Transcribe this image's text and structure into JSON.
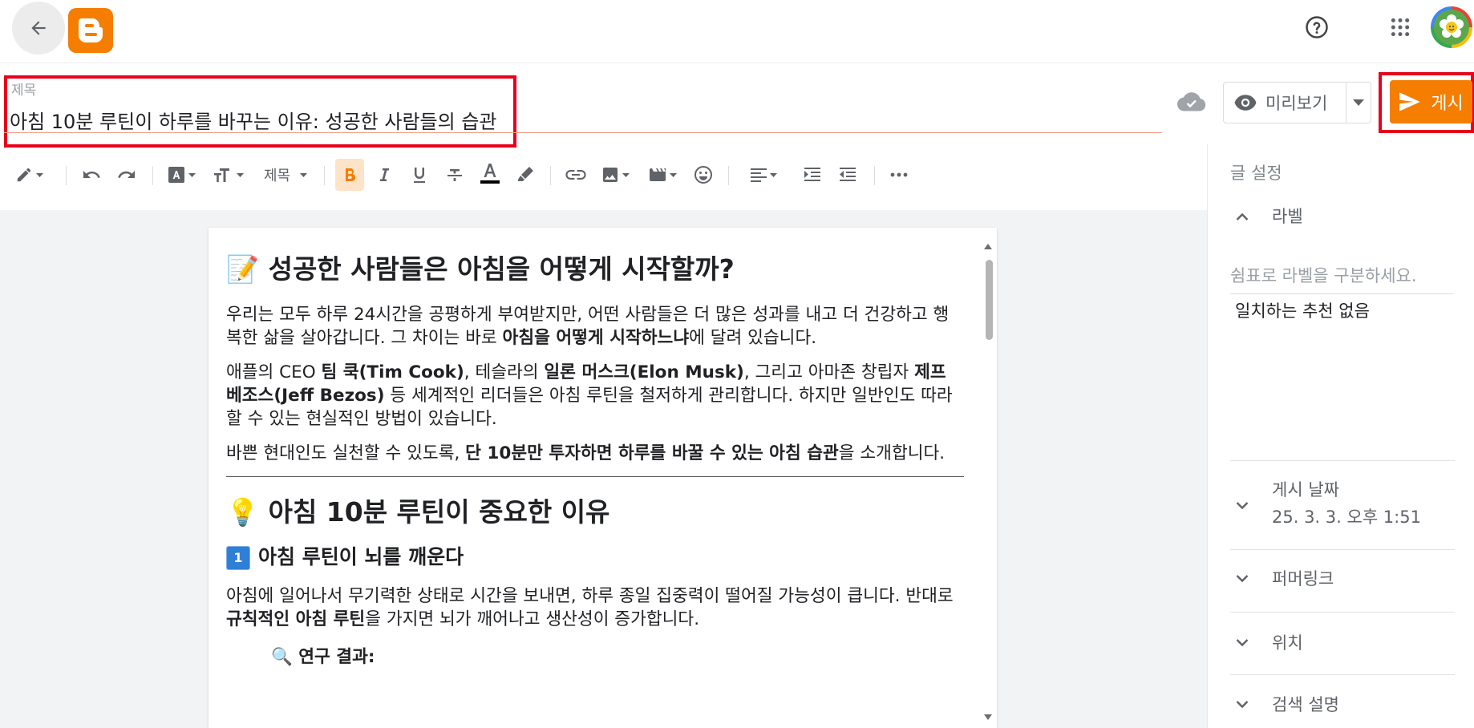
{
  "title": {
    "label": "제목",
    "value": "아침 10분 루틴이 하루를 바꾸는 이유: 성공한 사람들의 습관"
  },
  "header": {
    "preview_label": "미리보기",
    "publish_label": "게시"
  },
  "toolbar": {
    "format_label": "제목"
  },
  "content": {
    "h1": "📝 성공한 사람들은 아침을 어떻게 시작할까?",
    "p1_a": "우리는 모두 하루 24시간을 공평하게 부여받지만, 어떤 사람들은 더 많은 성과를 내고 더 건강하고 행복한 삶을 살아갑니다. 그 차이는 바로 ",
    "p1_b": "아침을 어떻게 시작하느냐",
    "p1_c": "에 달려 있습니다.",
    "p2_a": "애플의 CEO ",
    "p2_b": "팀 쿡(Tim Cook)",
    "p2_c": ", 테슬라의 ",
    "p2_d": "일론 머스크(Elon Musk)",
    "p2_e": ", 그리고 아마존 창립자 ",
    "p2_f": "제프 베조스(Jeff Bezos)",
    "p2_g": " 등 세계적인 리더들은 아침 루틴을 철저하게 관리합니다. 하지만 일반인도 따라 할 수 있는 현실적인 방법이 있습니다.",
    "p3_a": "바쁜 현대인도 실천할 수 있도록, ",
    "p3_b": "단 10분만 투자하면 하루를 바꿀 수 있는 아침 습관",
    "p3_c": "을 소개합니다.",
    "h2": "💡 아침 10분 루틴이 중요한 이유",
    "h3_num": "1",
    "h3_text": "아침 루틴이 뇌를 깨운다",
    "p4_a": "아침에 일어나서 무기력한 상태로 시간을 보내면, 하루 종일 집중력이 떨어질 가능성이 큽니다. 반대로 ",
    "p4_b": "규칙적인 아침 루틴",
    "p4_c": "을 가지면 뇌가 깨어나고 생산성이 증가합니다.",
    "sub": "🔍 연구 결과:"
  },
  "sidebar": {
    "heading": "글 설정",
    "labels_title": "라벨",
    "labels_placeholder": "쉼표로 라벨을 구분하세요.",
    "labels_no_suggest": "일치하는 추천 없음",
    "date_title": "게시 날짜",
    "date_value": "25. 3. 3. 오후 1:51",
    "permalink_title": "퍼머링크",
    "location_title": "위치",
    "search_desc_title": "검색 설명"
  },
  "colors": {
    "brand_orange": "#f57d00",
    "highlight_red": "#e8001c"
  }
}
